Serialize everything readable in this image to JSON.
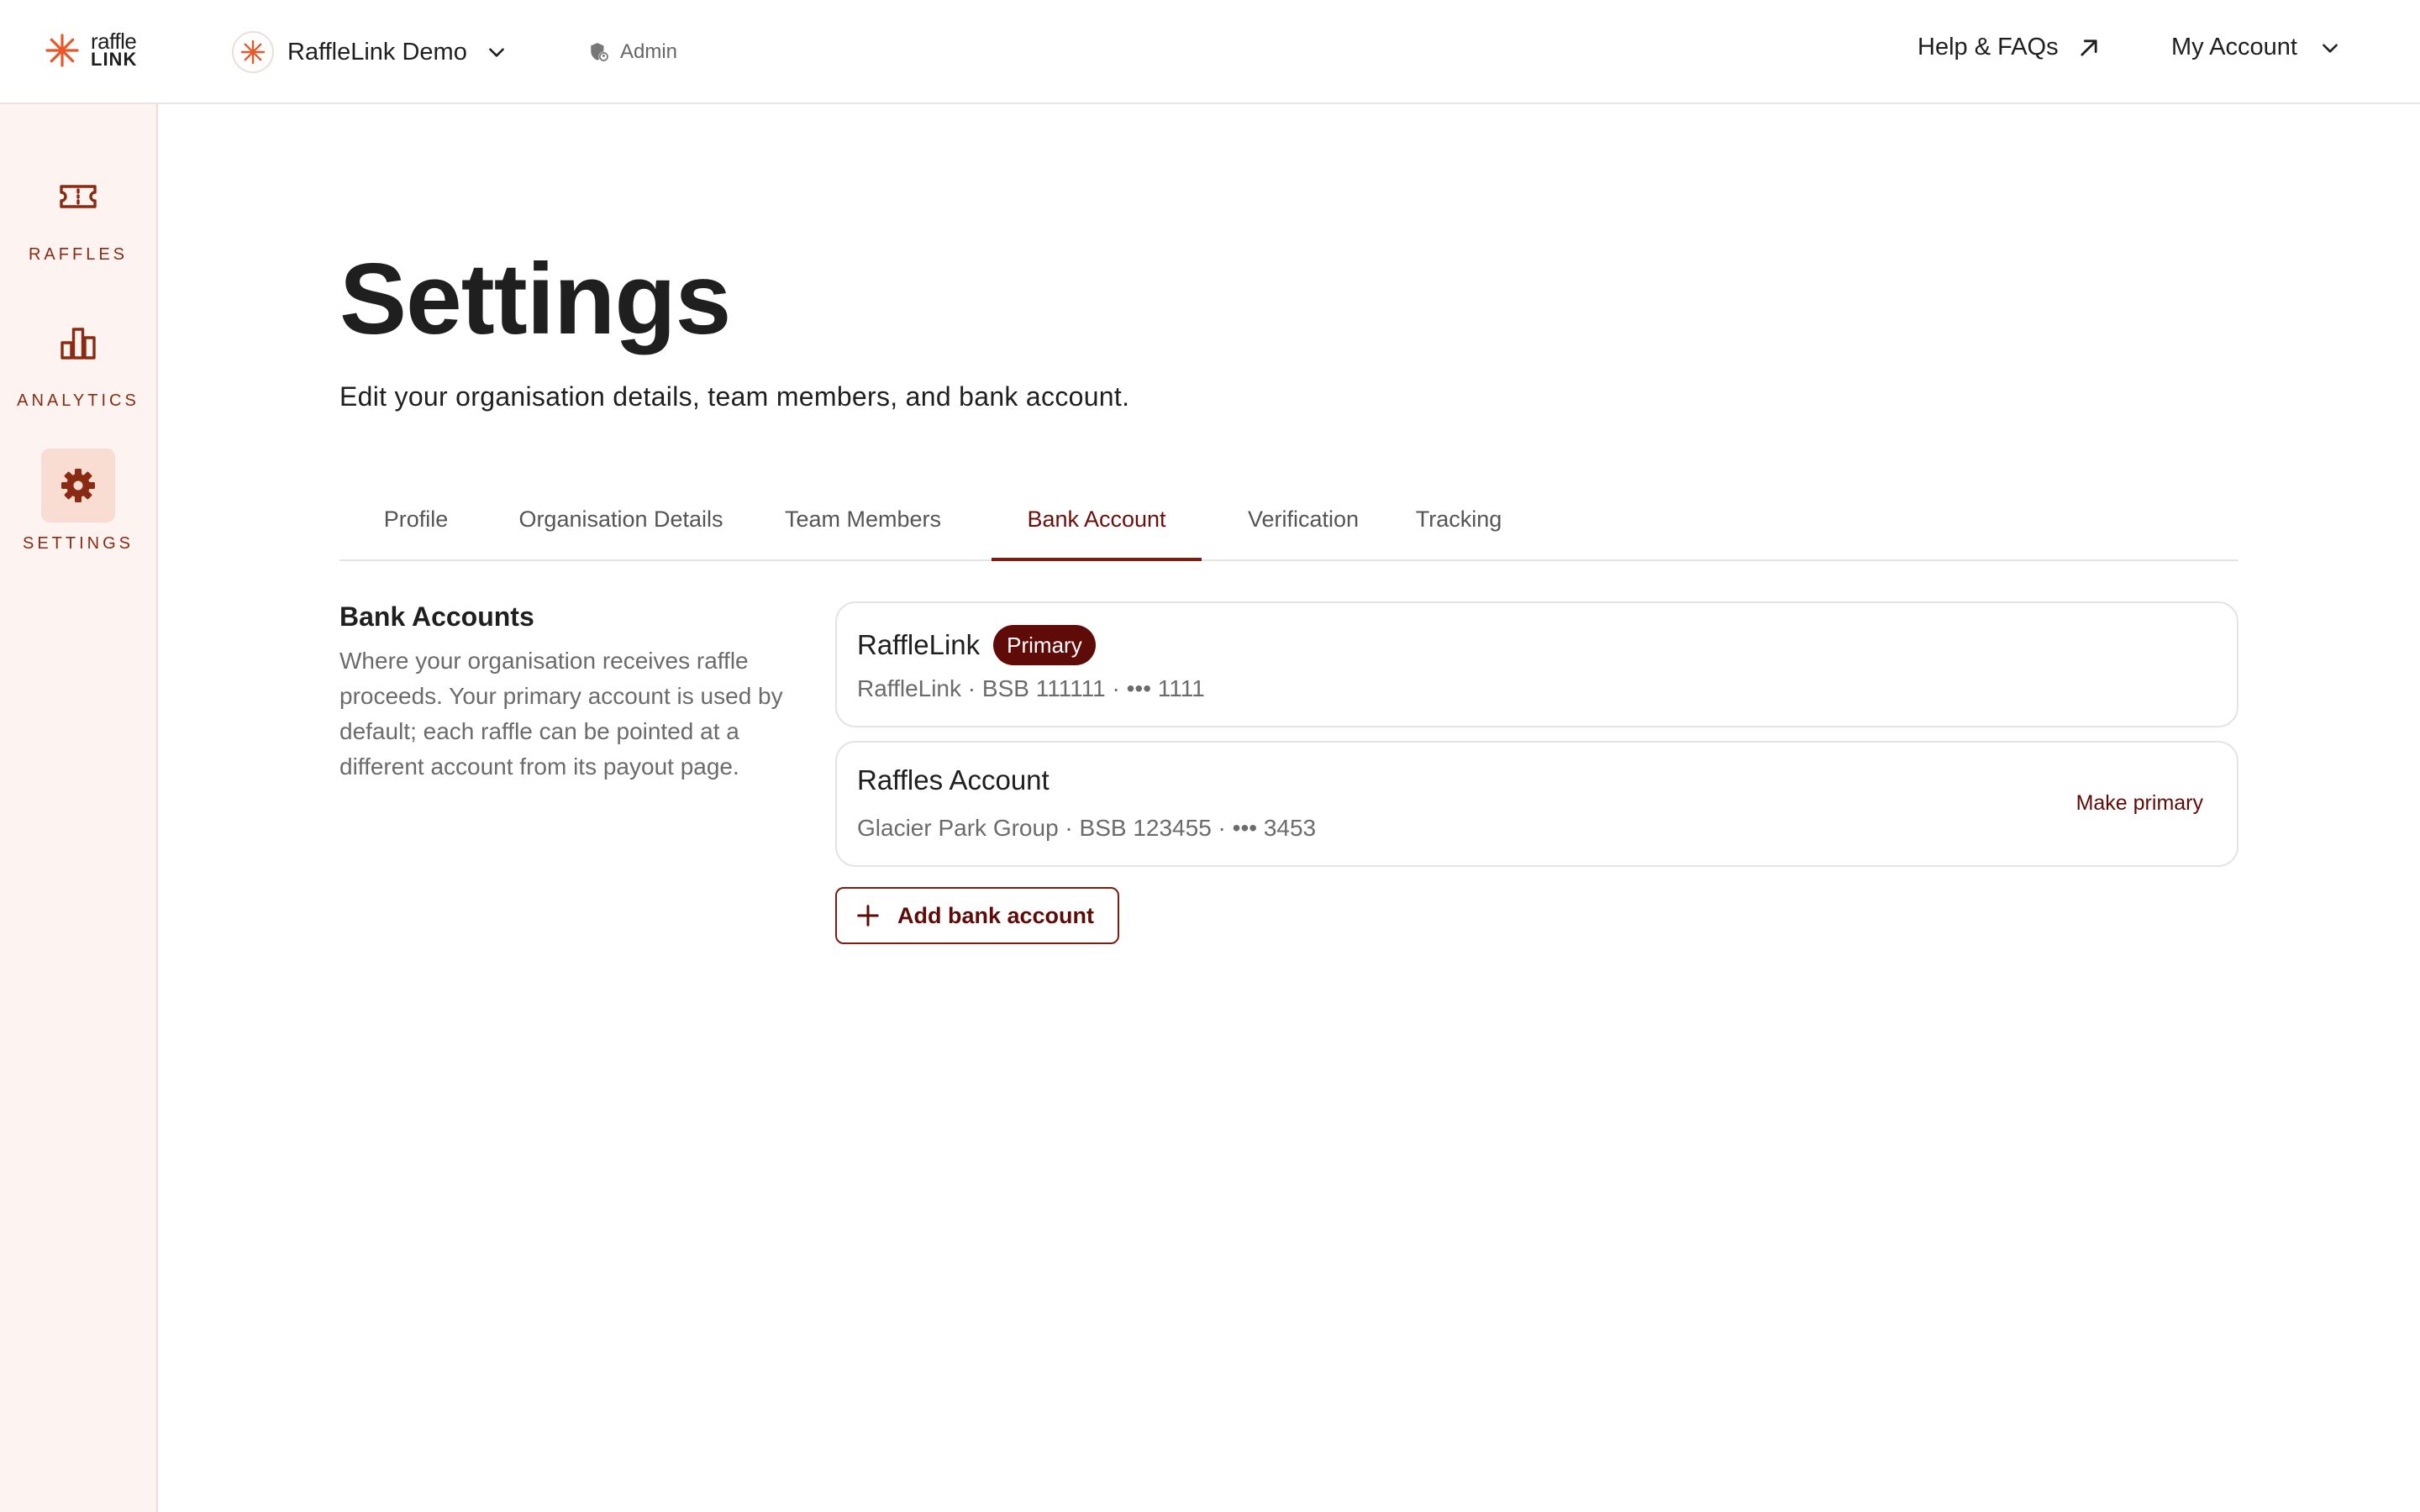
{
  "brand": {
    "logo_top": "raffle",
    "logo_bottom": "LINK"
  },
  "header": {
    "org_name": "RaffleLink Demo",
    "role": "Admin",
    "help_label": "Help & FAQs",
    "account_label": "My Account"
  },
  "sidebar": {
    "items": [
      {
        "label": "RAFFLES",
        "icon": "ticket-icon"
      },
      {
        "label": "ANALYTICS",
        "icon": "bar-chart-icon"
      },
      {
        "label": "SETTINGS",
        "icon": "gear-icon",
        "active": true
      }
    ]
  },
  "page": {
    "title": "Settings",
    "subtitle": "Edit your organisation details, team members, and bank account."
  },
  "tabs": [
    {
      "label": "Profile"
    },
    {
      "label": "Organisation Details"
    },
    {
      "label": "Team Members"
    },
    {
      "label": "Bank Account",
      "active": true
    },
    {
      "label": "Verification"
    },
    {
      "label": "Tracking"
    }
  ],
  "bank": {
    "title": "Bank Accounts",
    "description": "Where your organisation receives raffle proceeds. Your primary account is used by default; each raffle can be pointed at a different account from its payout page.",
    "accounts": [
      {
        "name": "RaffleLink",
        "badge": "Primary",
        "detail": "RaffleLink · BSB 111111 · ••• 1111"
      },
      {
        "name": "Raffles Account",
        "detail": "Glacier Park Group · BSB 123455 · ••• 3453",
        "action": "Make primary"
      }
    ],
    "add_label": "Add bank account"
  },
  "colors": {
    "accent": "#5f0b07",
    "brand_orange": "#e8572a",
    "sidebar_bg": "#fdf3f0",
    "sidebar_active_bg": "#f9dcd2"
  }
}
